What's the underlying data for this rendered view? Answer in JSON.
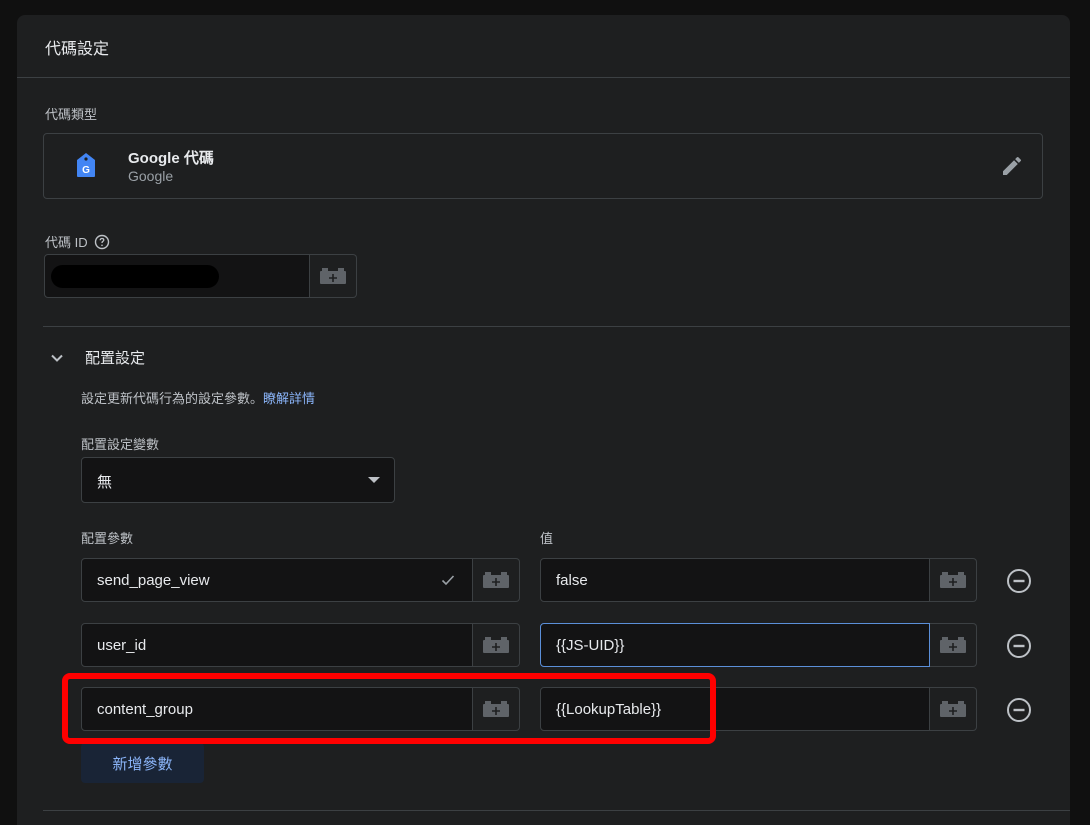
{
  "panel": {
    "title": "代碼設定"
  },
  "tag_type": {
    "label": "代碼類型",
    "name": "Google 代碼",
    "vendor": "Google"
  },
  "tag_id": {
    "label": "代碼 ID"
  },
  "config_section": {
    "title": "配置設定",
    "description": "設定更新代碼行為的設定參數。",
    "learn_more": "瞭解詳情",
    "variable_label": "配置設定變數",
    "variable_value": "無",
    "param_header": "配置參數",
    "value_header": "值",
    "rows": [
      {
        "param": "send_page_view",
        "value": "false"
      },
      {
        "param": "user_id",
        "value": "{{JS-UID}}"
      },
      {
        "param": "content_group",
        "value": "{{LookupTable}}"
      }
    ],
    "add_button": "新增參數"
  },
  "colors": {
    "accent": "#8ab4f8",
    "highlight": "#ff0000",
    "panel_bg": "#1e1f20"
  }
}
